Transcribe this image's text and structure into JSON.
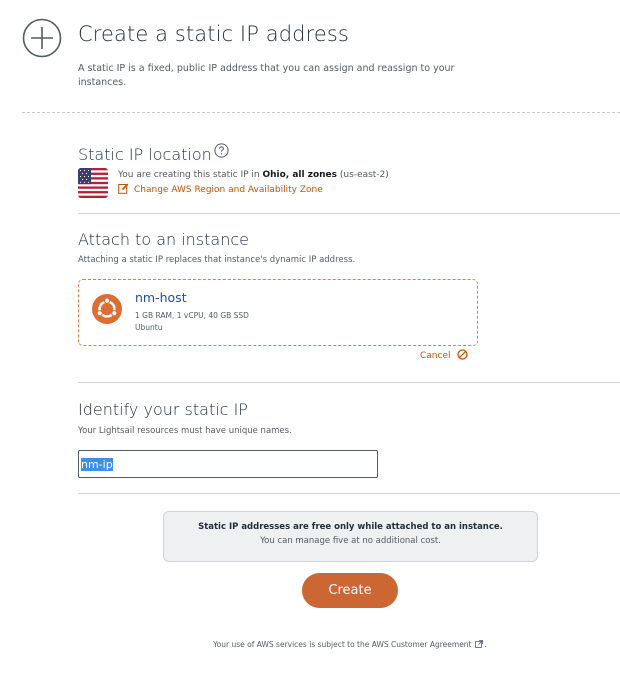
{
  "header": {
    "title": "Create a static IP address",
    "description": "A static IP is a fixed, public IP address that you can assign and reassign to your instances."
  },
  "location": {
    "heading": "Static IP location",
    "text_prefix": "You are creating this static IP in ",
    "region_bold": "Ohio, all zones",
    "region_code": " (us-east-2)",
    "change_link": "Change AWS Region and Availability Zone"
  },
  "attach": {
    "heading": "Attach to an instance",
    "subtitle": "Attaching a static IP replaces that instance's dynamic IP address.",
    "instance": {
      "name": "nm-host",
      "specs": "1 GB RAM, 1 vCPU, 40 GB SSD",
      "os": "Ubuntu"
    },
    "cancel_label": "Cancel"
  },
  "identify": {
    "heading": "Identify your static IP",
    "subtitle": "Your Lightsail resources must have unique names.",
    "input_value": "nm-ip"
  },
  "notice": {
    "title": "Static IP addresses are free only while attached to an instance.",
    "subtitle": "You can manage five at no additional cost."
  },
  "create_button": "Create",
  "footer": {
    "text": "Your use of AWS services is subject to the AWS Customer Agreement",
    "suffix": "."
  },
  "colors": {
    "accent_link": "#c45500",
    "button": "#cc6633",
    "instance_name": "#1d4e9f",
    "card_border": "#e07f3b"
  },
  "icons": [
    "plus-circle-icon",
    "help-icon",
    "us-flag-icon",
    "edit-icon",
    "ubuntu-icon",
    "cancel-icon",
    "external-link-icon"
  ]
}
